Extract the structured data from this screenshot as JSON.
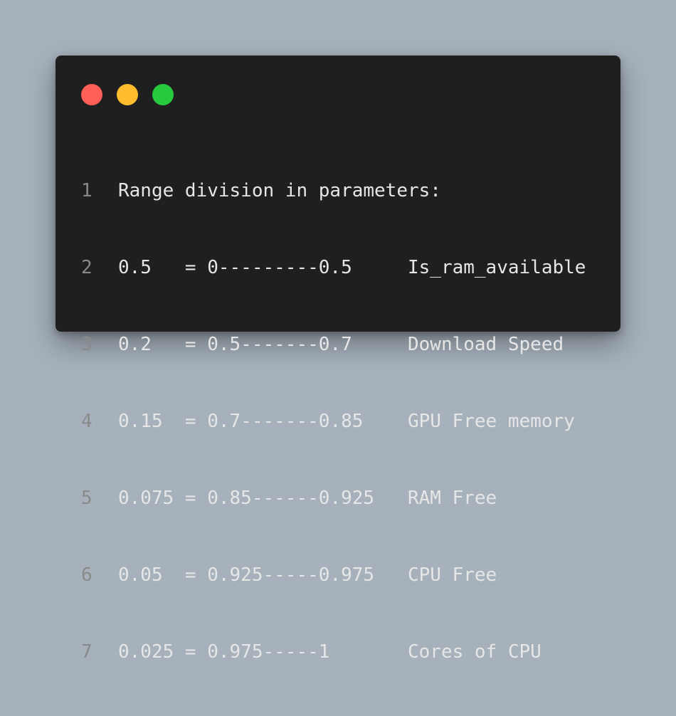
{
  "window": {
    "colors": {
      "close": "#ff5f56",
      "minimize": "#ffbd2e",
      "maximize": "#27c93f",
      "background": "#1f1f1f",
      "page": "#a6b1bc"
    }
  },
  "code": {
    "lines": [
      {
        "number": "1",
        "text": "Range division in parameters:"
      },
      {
        "number": "2",
        "text": "0.5   = 0---------0.5     Is_ram_available"
      },
      {
        "number": "3",
        "text": "0.2   = 0.5-------0.7     Download Speed"
      },
      {
        "number": "4",
        "text": "0.15  = 0.7-------0.85    GPU Free memory"
      },
      {
        "number": "5",
        "text": "0.075 = 0.85------0.925   RAM Free"
      },
      {
        "number": "6",
        "text": "0.05  = 0.925-----0.975   CPU Free"
      },
      {
        "number": "7",
        "text": "0.025 = 0.975-----1       Cores of CPU"
      }
    ]
  }
}
